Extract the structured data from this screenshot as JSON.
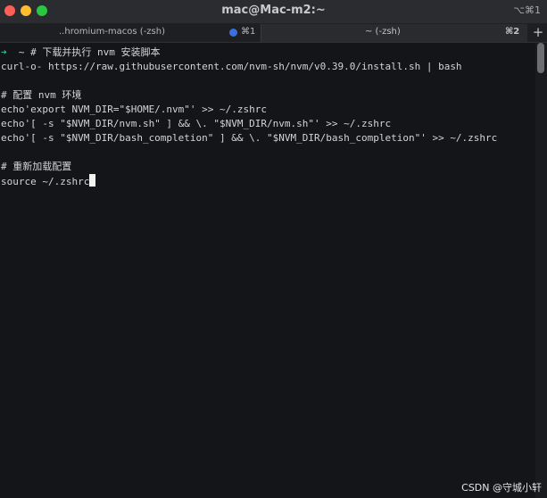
{
  "window": {
    "title": "mac@Mac-m2:~",
    "shortcut": "⌥⌘1"
  },
  "tabs": [
    {
      "title": "..hromium-macos (-zsh)",
      "number": "⌘1"
    },
    {
      "title": "~ (-zsh)",
      "number": "⌘2"
    }
  ],
  "new_tab_label": "+",
  "terminal": {
    "prompt_arrow": "➜",
    "prompt_dir": "~",
    "lines": [
      "# 下载并执行 nvm 安装脚本",
      "curl-o- https://raw.githubusercontent.com/nvm-sh/nvm/v0.39.0/install.sh | bash",
      "",
      "# 配置 nvm 环境",
      "echo'export NVM_DIR=\"$HOME/.nvm\"' >> ~/.zshrc",
      "echo'[ -s \"$NVM_DIR/nvm.sh\" ] && \\. \"$NVM_DIR/nvm.sh\"' >> ~/.zshrc",
      "echo'[ -s \"$NVM_DIR/bash_completion\" ] && \\. \"$NVM_DIR/bash_completion\"' >> ~/.zshrc",
      "",
      "# 重新加载配置",
      "source ~/.zshrc"
    ]
  },
  "watermark": "CSDN @守城小轩"
}
